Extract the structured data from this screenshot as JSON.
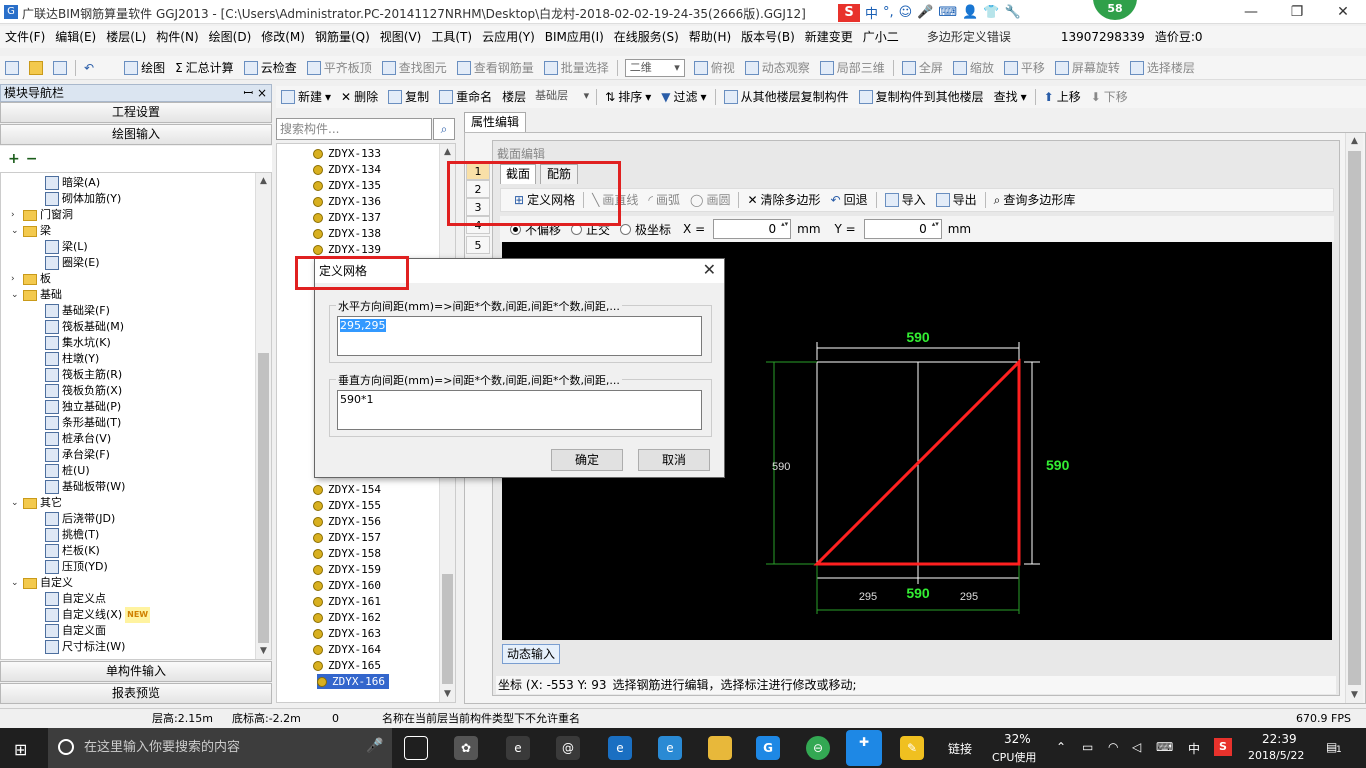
{
  "window": {
    "title": "广联达BIM钢筋算量软件 GGJ2013 - [C:\\Users\\Administrator.PC-20141127NRHM\\Desktop\\白龙村-2018-02-02-19-24-35(2666版).GGJ12]",
    "min_glyph": "—",
    "max_glyph": "❐",
    "close_glyph": "✕",
    "badge": "58",
    "ime": {
      "logo": "S",
      "cn": "中",
      "dot": "°,"
    }
  },
  "menubar": {
    "items": [
      "文件(F)",
      "编辑(E)",
      "楼层(L)",
      "构件(N)",
      "绘图(D)",
      "修改(M)",
      "钢筋量(Q)",
      "视图(V)",
      "工具(T)",
      "云应用(Y)",
      "BIM应用(I)",
      "在线服务(S)",
      "帮助(H)",
      "版本号(B)",
      "新建变更",
      "广小二"
    ],
    "notice": "多边形定义错误",
    "phone": "13907298339",
    "score": "造价豆:0"
  },
  "toolbar1": {
    "draw": "绘图",
    "sum": "汇总计算",
    "cloud_check": "云检查",
    "flat_top": "平齐板顶",
    "find_elem": "查找图元",
    "view_rebar": "查看钢筋量",
    "batch_select": "批量选择",
    "view_mode": "二维",
    "top_view": "俯视",
    "dynamic_view": "动态观察",
    "local_3d": "局部三维",
    "fullscreen": "全屏",
    "zoom": "缩放",
    "pan": "平移",
    "rotate": "屏幕旋转",
    "select_floor": "选择楼层"
  },
  "nav": {
    "title": "模块导航栏",
    "pin": "ꟷ ×",
    "project_settings": "工程设置",
    "drawing_input": "绘图输入",
    "single_input": "单构件输入",
    "report_preview": "报表预览",
    "tree": [
      {
        "label": "暗梁(A)",
        "level": 2,
        "type": "leaf"
      },
      {
        "label": "砌体加筋(Y)",
        "level": 2,
        "type": "leaf"
      },
      {
        "label": "门窗洞",
        "level": 1,
        "type": "folder",
        "exp": "›"
      },
      {
        "label": "梁",
        "level": 1,
        "type": "folder",
        "exp": "⌄"
      },
      {
        "label": "梁(L)",
        "level": 2,
        "type": "leaf"
      },
      {
        "label": "圈梁(E)",
        "level": 2,
        "type": "leaf"
      },
      {
        "label": "板",
        "level": 1,
        "type": "folder",
        "exp": "›"
      },
      {
        "label": "基础",
        "level": 1,
        "type": "folder",
        "exp": "⌄"
      },
      {
        "label": "基础梁(F)",
        "level": 2,
        "type": "leaf"
      },
      {
        "label": "筏板基础(M)",
        "level": 2,
        "type": "leaf"
      },
      {
        "label": "集水坑(K)",
        "level": 2,
        "type": "leaf"
      },
      {
        "label": "柱墩(Y)",
        "level": 2,
        "type": "leaf"
      },
      {
        "label": "筏板主筋(R)",
        "level": 2,
        "type": "leaf"
      },
      {
        "label": "筏板负筋(X)",
        "level": 2,
        "type": "leaf"
      },
      {
        "label": "独立基础(P)",
        "level": 2,
        "type": "leaf"
      },
      {
        "label": "条形基础(T)",
        "level": 2,
        "type": "leaf"
      },
      {
        "label": "桩承台(V)",
        "level": 2,
        "type": "leaf"
      },
      {
        "label": "承台梁(F)",
        "level": 2,
        "type": "leaf"
      },
      {
        "label": "桩(U)",
        "level": 2,
        "type": "leaf"
      },
      {
        "label": "基础板带(W)",
        "level": 2,
        "type": "leaf"
      },
      {
        "label": "其它",
        "level": 1,
        "type": "folder",
        "exp": "⌄"
      },
      {
        "label": "后浇带(JD)",
        "level": 2,
        "type": "leaf"
      },
      {
        "label": "挑檐(T)",
        "level": 2,
        "type": "leaf"
      },
      {
        "label": "栏板(K)",
        "level": 2,
        "type": "leaf"
      },
      {
        "label": "压顶(YD)",
        "level": 2,
        "type": "leaf"
      },
      {
        "label": "自定义",
        "level": 1,
        "type": "folder",
        "exp": "⌄"
      },
      {
        "label": "自定义点",
        "level": 2,
        "type": "leaf"
      },
      {
        "label": "自定义线(X)",
        "level": 2,
        "type": "leaf",
        "badge": "NEW"
      },
      {
        "label": "自定义面",
        "level": 2,
        "type": "leaf"
      },
      {
        "label": "尺寸标注(W)",
        "level": 2,
        "type": "leaf"
      }
    ]
  },
  "comp_toolbar": {
    "new": "新建",
    "delete": "删除",
    "copy": "复制",
    "rename": "重命名",
    "floor_label": "楼层",
    "floor_value": "基础层",
    "sort": "排序",
    "filter": "过滤",
    "copy_from": "从其他楼层复制构件",
    "copy_to": "复制构件到其他楼层",
    "find": "查找",
    "move_up": "上移",
    "move_down": "下移"
  },
  "search": {
    "placeholder": "搜索构件...",
    "icon": "⌕"
  },
  "components_top": [
    "ZDYX-133",
    "ZDYX-134",
    "ZDYX-135",
    "ZDYX-136",
    "ZDYX-137",
    "ZDYX-138",
    "ZDYX-139"
  ],
  "components_bottom": [
    "ZDYX-154",
    "ZDYX-155",
    "ZDYX-156",
    "ZDYX-157",
    "ZDYX-158",
    "ZDYX-159",
    "ZDYX-160",
    "ZDYX-161",
    "ZDYX-162",
    "ZDYX-163",
    "ZDYX-164",
    "ZDYX-165",
    "ZDYX-166"
  ],
  "property": {
    "tab": "属性编辑",
    "rows": [
      "1",
      "2",
      "3",
      "4",
      "5"
    ],
    "editor_title": "截面编辑",
    "tabs": [
      "截面",
      "配筋"
    ],
    "toolbar": {
      "define_grid": "定义网格",
      "draw_line": "画直线",
      "draw_arc": "画弧",
      "draw_circle": "画圆",
      "clear_polygon": "清除多边形",
      "undo": "回退",
      "import": "导入",
      "export": "导出",
      "query_lib": "查询多边形库"
    },
    "offset": {
      "none": "不偏移",
      "ortho": "正交",
      "polar": "极坐标",
      "x_label": "X =",
      "x_value": "0",
      "y_label": "Y =",
      "y_value": "0",
      "unit": "mm"
    },
    "drawing": {
      "top_dim": "590",
      "right_dim": "590",
      "left_dim": "590",
      "bottom_dim": "590",
      "bottom_left": "295",
      "bottom_right": "295"
    },
    "dynamic_input": "动态输入",
    "coords": "坐标 (X: -553 Y: 93",
    "hint": "选择钢筋进行编辑，选择标注进行修改或移动;"
  },
  "dialog": {
    "title": "定义网格",
    "close": "✕",
    "h_label": "水平方向间距(mm)=>间距*个数,间距,间距*个数,间距,...",
    "h_value": "295,295",
    "v_label": "垂直方向间距(mm)=>间距*个数,间距,间距*个数,间距,...",
    "v_value": "590*1",
    "ok": "确定",
    "cancel": "取消"
  },
  "statusbar": {
    "floor_height": "层高:2.15m",
    "bottom_elev": "底标高:-2.2m",
    "count": "0",
    "message": "名称在当前层当前构件类型下不允许重名",
    "fps": "670.9 FPS"
  },
  "taskbar": {
    "search_placeholder": "在这里输入你要搜索的内容",
    "link": "链接",
    "cpu_pct": "32%",
    "cpu_label": "CPU使用",
    "lang": "中",
    "time": "22:39",
    "date": "2018/5/22",
    "notif": "1"
  },
  "colors": {
    "accent": "#3366cc",
    "red_highlight": "#e02020",
    "dim_green": "#33ee33",
    "polygon_red": "#ff2020"
  }
}
